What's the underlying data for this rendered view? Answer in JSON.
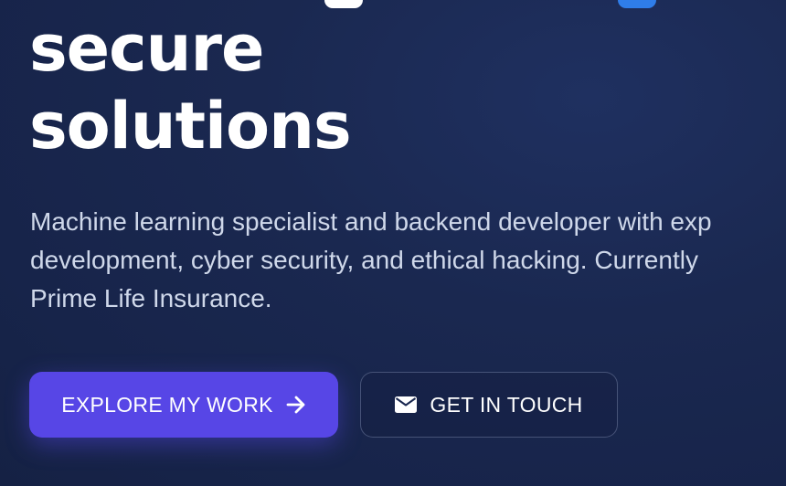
{
  "hero": {
    "title_line_1": "secure",
    "title_line_2": "solutions",
    "description_lines": [
      "Machine learning specialist and backend developer with exp",
      "development, cyber security, and ethical hacking. Currently",
      "Prime Life Insurance."
    ]
  },
  "buttons": {
    "primary_label": "EXPLORE MY WORK",
    "primary_icon": "arrow-right-icon",
    "secondary_label": "GET IN TOUCH",
    "secondary_icon": "envelope-icon"
  },
  "colors": {
    "background": "#1a2850",
    "primary_button": "#5746e6",
    "accent_blue": "#2f7de9",
    "heading": "#ffffff",
    "body_text": "#cfd8ea"
  }
}
